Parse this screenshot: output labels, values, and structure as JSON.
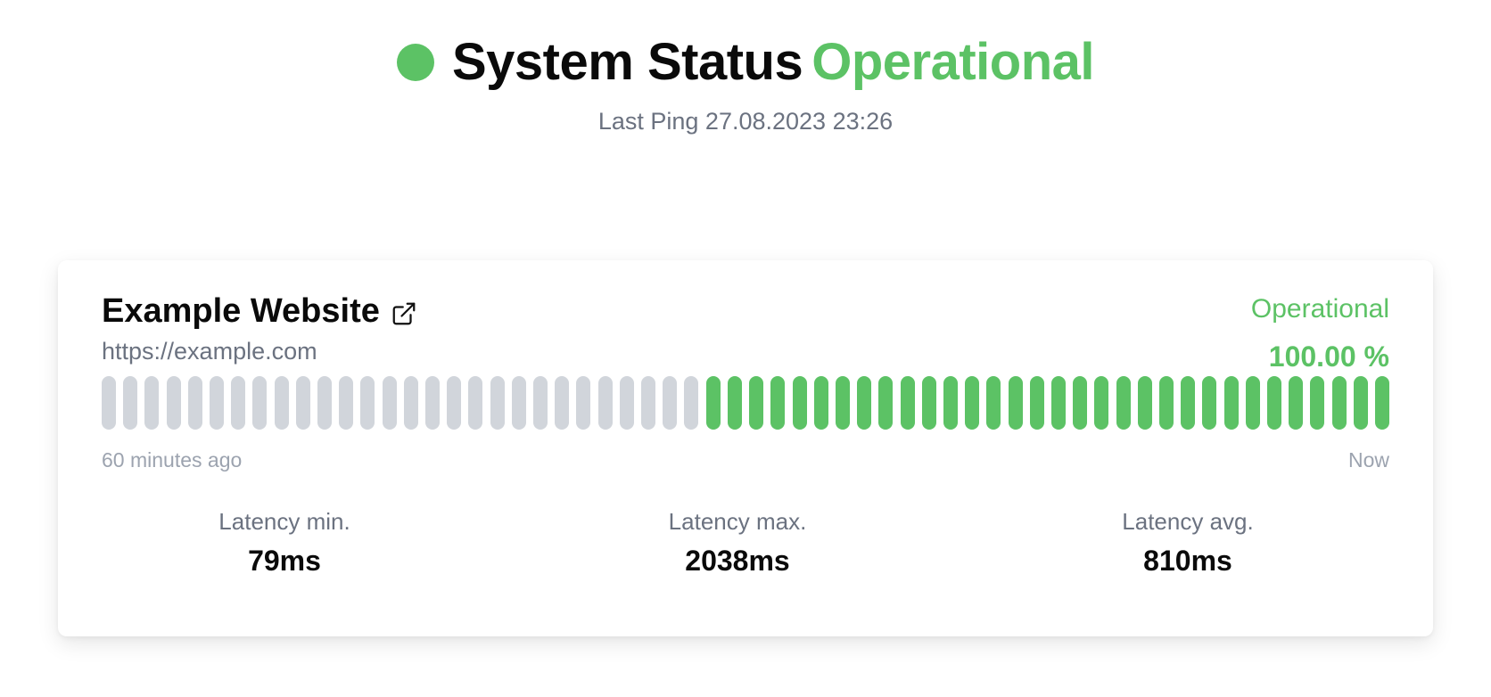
{
  "header": {
    "title": "System Status",
    "state": "Operational",
    "last_ping": "Last Ping 27.08.2023 23:26",
    "status_icon": "status-dot"
  },
  "colors": {
    "operational": "#5cc265",
    "inactive": "#d1d5db"
  },
  "monitor": {
    "name": "Example Website",
    "link_icon": "external-link-icon",
    "url": "https://example.com",
    "status": "Operational",
    "uptime": "100.00 %",
    "history_start_label": "60 minutes ago",
    "history_end_label": "Now",
    "history": {
      "total_slots": 60,
      "no_data_slots": 28,
      "operational_slots": 32
    },
    "stats": [
      {
        "label": "Latency min.",
        "value": "79ms"
      },
      {
        "label": "Latency max.",
        "value": "2038ms"
      },
      {
        "label": "Latency avg.",
        "value": "810ms"
      }
    ]
  }
}
